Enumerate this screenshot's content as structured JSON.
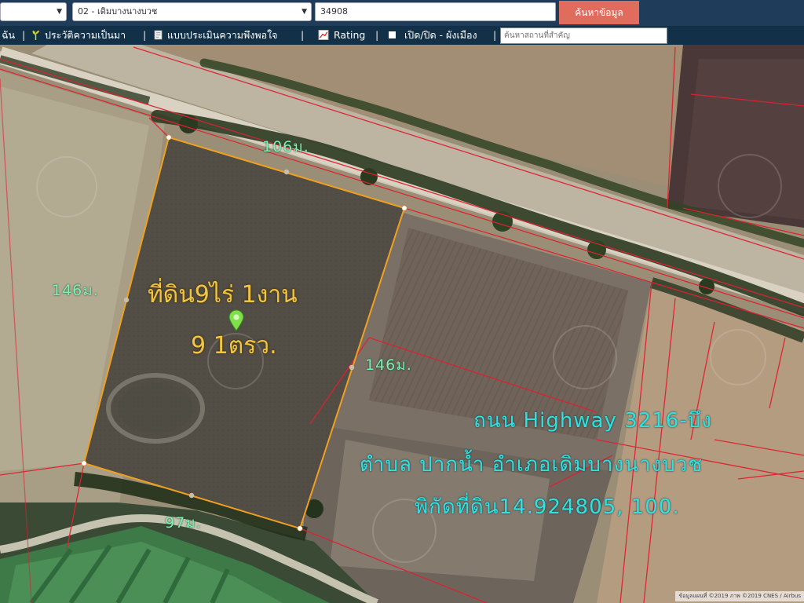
{
  "search": {
    "province_value": "",
    "district_value": "02 - เดิมบางนางบวช",
    "parcel_value": "34908",
    "submit_label": "ค้นหาข้อมูล"
  },
  "menu": {
    "item0": "ฉัน",
    "history": "ประวัติความเป็นมา",
    "survey": "แบบประเมินความพึงพอใจ",
    "rating": "Rating",
    "toggle_zoning": "เปิด/ปิด - ผังเมือง",
    "place_search_placeholder": "ค้นหาสถานที่สำคัญ"
  },
  "map": {
    "measurements": {
      "top": "106ม.",
      "left": "146ม.",
      "right": "146ม.",
      "bottom": "97ม."
    },
    "land_area_line1": "ที่ดิน9ไร่ 1งาน",
    "land_area_line2": "9 1ตรว.",
    "road_info": "ถนน Highway 3216-บึง",
    "location_info": "ตำบล ปากน้ำ อำเภอเดิมบางนางบวช",
    "coords_info": "พิกัดที่ดิน14.924805, 100.",
    "attribution": "ข้อมูลแผนที่ ©2019 ภาพ ©2019 CNES / Airbus",
    "colors": {
      "parcel_outline": "#f0a020",
      "boundary": "#e02030",
      "measure": "#7ff0b0",
      "label": "#f2c440",
      "info": "#32e0de"
    },
    "icons": [
      "location-pin-icon",
      "history-icon",
      "survey-icon",
      "rating-icon"
    ]
  }
}
